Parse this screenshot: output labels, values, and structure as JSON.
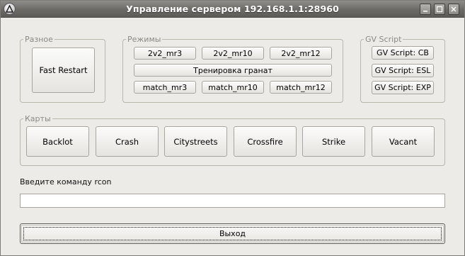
{
  "window": {
    "title": "Управление сервером 192.168.1.1:28960"
  },
  "groups": {
    "misc": {
      "legend": "Разное",
      "fast_restart": "Fast Restart"
    },
    "modes": {
      "legend": "Режимы",
      "row1": [
        "2v2_mr3",
        "2v2_mr10",
        "2v2_mr12"
      ],
      "grenades": "Тренировка гранат",
      "row3": [
        "match_mr3",
        "match_mr10",
        "match_mr12"
      ]
    },
    "gv_script": {
      "legend": "GV Script",
      "buttons": [
        "GV Script: CB",
        "GV Script: ESL",
        "GV Script: EXP"
      ]
    },
    "maps": {
      "legend": "Карты",
      "buttons": [
        "Backlot",
        "Crash",
        "Citystreets",
        "Crossfire",
        "Strike",
        "Vacant"
      ]
    }
  },
  "rcon": {
    "label": "Введите команду rcon",
    "value": ""
  },
  "exit_label": "Выход"
}
